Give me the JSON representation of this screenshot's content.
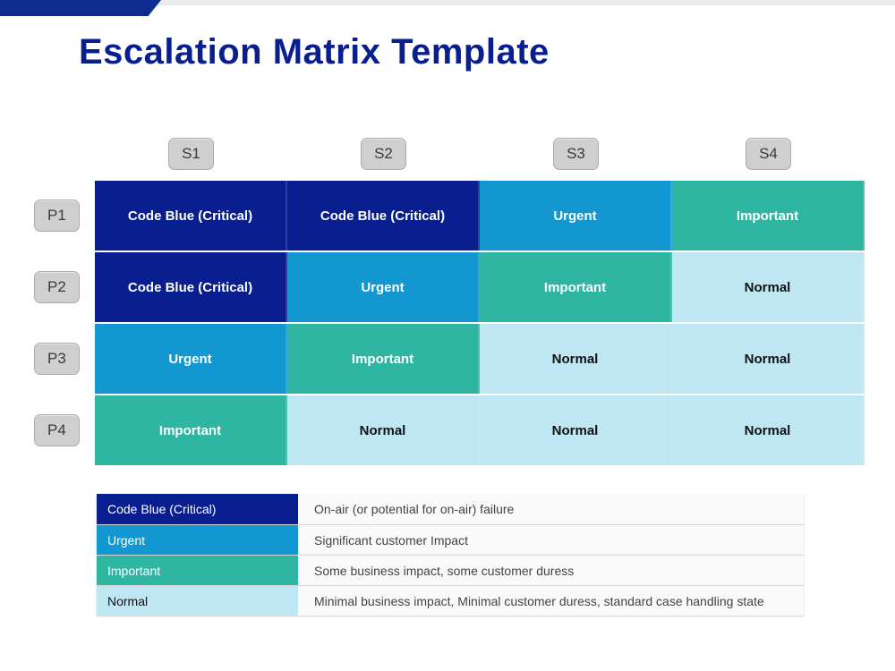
{
  "title": "Escalation Matrix Template",
  "severity_headers": [
    "S1",
    "S2",
    "S3",
    "S4"
  ],
  "priority_headers": [
    "P1",
    "P2",
    "P3",
    "P4"
  ],
  "levels": {
    "critical": {
      "label": "Code Blue (Critical)",
      "css": "c-critical"
    },
    "urgent": {
      "label": "Urgent",
      "css": "c-urgent"
    },
    "important": {
      "label": "Important",
      "css": "c-important"
    },
    "normal": {
      "label": "Normal",
      "css": "c-normal"
    }
  },
  "matrix": [
    [
      "critical",
      "critical",
      "urgent",
      "important"
    ],
    [
      "critical",
      "urgent",
      "important",
      "normal"
    ],
    [
      "urgent",
      "important",
      "normal",
      "normal"
    ],
    [
      "important",
      "normal",
      "normal",
      "normal"
    ]
  ],
  "legend": [
    {
      "level": "critical",
      "desc": "On-air (or potential for on-air) failure"
    },
    {
      "level": "urgent",
      "desc": "Significant customer Impact"
    },
    {
      "level": "important",
      "desc": "Some business impact, some customer duress"
    },
    {
      "level": "normal",
      "desc": "Minimal business impact, Minimal customer duress, standard case handling state"
    }
  ]
}
